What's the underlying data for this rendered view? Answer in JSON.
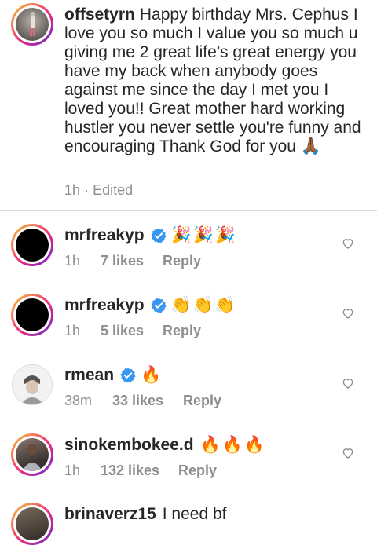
{
  "caption": {
    "username": "offsetyrn",
    "text": "Happy birthday Mrs. Cephus I love you so much I value you so much u giving me 2 great life’s great energy you have my back when anybody goes against me since the day I met you I loved you!! Great mother hard working hustler you never settle you're funny and encouraging Thank God for you 🙏🏾",
    "time": "1h",
    "separator": "·",
    "edited": "Edited"
  },
  "comments": [
    {
      "username": "mrfreakyp",
      "verified": true,
      "text": "🎉🎉🎉",
      "time": "1h",
      "likes": "7 likes",
      "reply": "Reply"
    },
    {
      "username": "mrfreakyp",
      "verified": true,
      "text": "👏👏👏",
      "time": "1h",
      "likes": "5 likes",
      "reply": "Reply"
    },
    {
      "username": "rmean",
      "verified": true,
      "text": "🔥",
      "time": "38m",
      "likes": "33 likes",
      "reply": "Reply"
    },
    {
      "username": "sinokembokee.d",
      "verified": false,
      "text": "🔥🔥🔥",
      "time": "1h",
      "likes": "132 likes",
      "reply": "Reply"
    },
    {
      "username": "brinaverz15",
      "verified": false,
      "text": "I need bf",
      "time": "",
      "likes": "",
      "reply": ""
    }
  ],
  "icons": {
    "verified": "verified-badge-icon",
    "heart": "heart-outline-icon"
  },
  "colors": {
    "verified": "#3897f0",
    "meta": "#8e8e8e",
    "text": "#262626"
  }
}
